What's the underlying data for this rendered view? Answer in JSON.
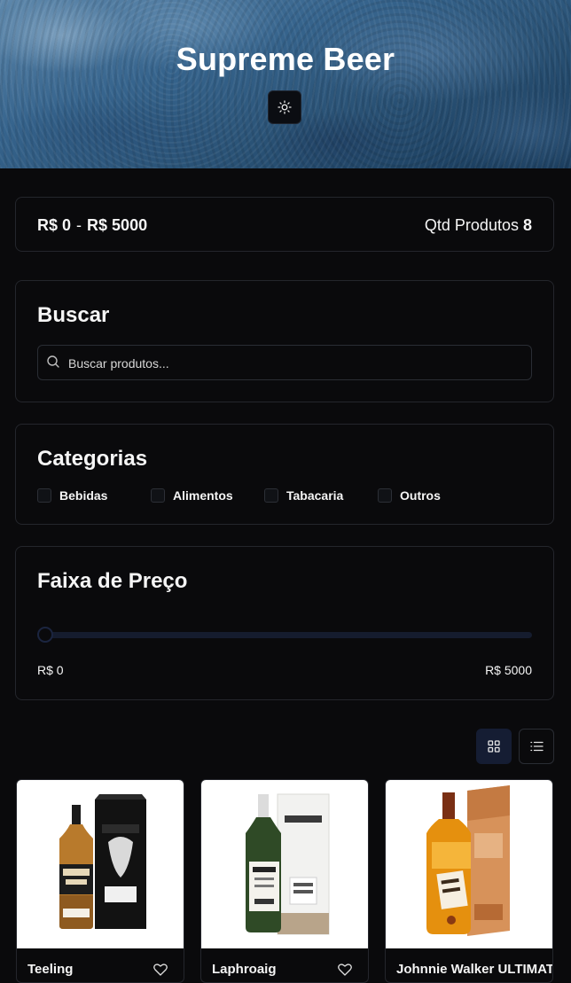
{
  "header": {
    "title": "Supreme Beer",
    "theme_icon": "sun-icon"
  },
  "summary": {
    "min_price": "R$ 0",
    "separator": "-",
    "max_price": "R$ 5000",
    "qty_label": "Qtd Produtos",
    "qty_value": "8"
  },
  "search": {
    "title": "Buscar",
    "placeholder": "Buscar produtos...",
    "value": "",
    "icon": "search-icon"
  },
  "categories": {
    "title": "Categorias",
    "items": [
      {
        "label": "Bebidas",
        "checked": false
      },
      {
        "label": "Alimentos",
        "checked": false
      },
      {
        "label": "Tabacaria",
        "checked": false
      },
      {
        "label": "Outros",
        "checked": false
      }
    ]
  },
  "price_range": {
    "title": "Faixa de Preço",
    "min_label": "R$ 0",
    "max_label": "R$ 5000",
    "slider_fraction": 0
  },
  "view_toggle": {
    "active": "grid",
    "grid_icon": "grid-icon",
    "list_icon": "list-icon"
  },
  "products": [
    {
      "name": "Teeling",
      "icon": "heart-icon"
    },
    {
      "name": "Laphroaig",
      "icon": "heart-icon"
    },
    {
      "name": "Johnnie Walker ULTIMATE",
      "icon": "heart-icon"
    }
  ],
  "colors": {
    "background": "#0a0a0c",
    "accent": "#151d33",
    "border": "#24262c",
    "text": "#f5f5f5"
  }
}
